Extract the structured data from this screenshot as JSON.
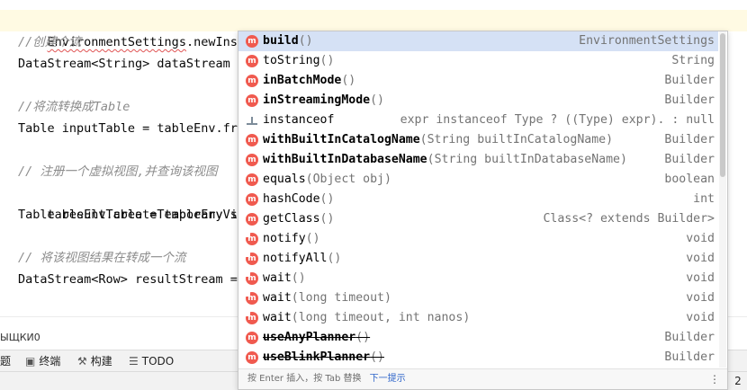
{
  "editor": {
    "lines": [
      {
        "text_a": "EnvironmentSettings",
        "text_b": ".newInstance()",
        "text_c": ".;",
        "comment": false
      },
      {
        "text": "//创建个流",
        "comment": true
      },
      {
        "text": "DataStream<String> dataStream = ",
        "comment": false
      },
      {
        "text": "//将流转换成Table",
        "comment": true
      },
      {
        "text": "Table inputTable = tableEnv.fro",
        "comment": false
      },
      {
        "text": "// 注册一个虚拟视图,并查询该视图",
        "comment": true
      },
      {
        "text": "tableEnv.createTemporaryView(",
        "hint": "s",
        "comment": false
      },
      {
        "text": "Table resultTable = tableEnv.sq",
        "comment": false
      },
      {
        "text": "// 将该视图结果在转成一个流",
        "comment": true
      },
      {
        "text": "DataStream<Row> resultStream = ",
        "comment": false
      }
    ]
  },
  "completion": {
    "items": [
      {
        "icon": "method-icon",
        "name": "build",
        "sig": "()",
        "type": "EnvironmentSettings",
        "bold": true,
        "inherited": false,
        "strike": false
      },
      {
        "icon": "method-icon",
        "name": "toString",
        "sig": "()",
        "type": "String",
        "bold": false,
        "inherited": false,
        "strike": false
      },
      {
        "icon": "method-icon",
        "name": "inBatchMode",
        "sig": "()",
        "type": "Builder",
        "bold": true,
        "inherited": false,
        "strike": false
      },
      {
        "icon": "method-icon",
        "name": "inStreamingMode",
        "sig": "()",
        "type": "Builder",
        "bold": true,
        "inherited": false,
        "strike": false
      },
      {
        "icon": "template-icon",
        "name": "instanceof",
        "sig": "",
        "type": "expr instanceof Type ? ((Type) expr). : null",
        "bold": false,
        "inherited": false,
        "strike": false
      },
      {
        "icon": "method-icon",
        "name": "withBuiltInCatalogName",
        "sig": "(String builtInCatalogName)",
        "type": "Builder",
        "bold": true,
        "inherited": false,
        "strike": false
      },
      {
        "icon": "method-icon",
        "name": "withBuiltInDatabaseName",
        "sig": "(String builtInDatabaseName)",
        "type": "Builder",
        "bold": true,
        "inherited": false,
        "strike": false
      },
      {
        "icon": "method-icon",
        "name": "equals",
        "sig": "(Object obj)",
        "type": "boolean",
        "bold": false,
        "inherited": false,
        "strike": false
      },
      {
        "icon": "method-icon",
        "name": "hashCode",
        "sig": "()",
        "type": "int",
        "bold": false,
        "inherited": false,
        "strike": false
      },
      {
        "icon": "method-icon",
        "name": "getClass",
        "sig": "()",
        "type": "Class<? extends Builder>",
        "bold": false,
        "inherited": false,
        "strike": false
      },
      {
        "icon": "method-icon",
        "name": "notify",
        "sig": "()",
        "type": "void",
        "bold": false,
        "inherited": true,
        "strike": false
      },
      {
        "icon": "method-icon",
        "name": "notifyAll",
        "sig": "()",
        "type": "void",
        "bold": false,
        "inherited": true,
        "strike": false
      },
      {
        "icon": "method-icon",
        "name": "wait",
        "sig": "()",
        "type": "void",
        "bold": false,
        "inherited": true,
        "strike": false
      },
      {
        "icon": "method-icon",
        "name": "wait",
        "sig": "(long timeout)",
        "type": "void",
        "bold": false,
        "inherited": true,
        "strike": false
      },
      {
        "icon": "method-icon",
        "name": "wait",
        "sig": "(long timeout, int nanos)",
        "type": "void",
        "bold": false,
        "inherited": true,
        "strike": false
      },
      {
        "icon": "method-icon",
        "name": "useAnyPlanner",
        "sig": "()",
        "type": "Builder",
        "bold": true,
        "inherited": false,
        "strike": true
      },
      {
        "icon": "method-icon",
        "name": "useBlinkPlanner",
        "sig": "()",
        "type": "Builder",
        "bold": true,
        "inherited": false,
        "strike": true
      }
    ],
    "badge_letter": "m",
    "footer_text": "按 Enter 插入，按 Tab 替换",
    "footer_link": "下一提示",
    "footer_menu": "⋮"
  },
  "cut_text": "ЫЩКИ0",
  "toolwindows": [
    {
      "label": "题",
      "icon": "problems-icon",
      "glyph": ""
    },
    {
      "label": "终端",
      "icon": "terminal-icon",
      "glyph": "▣"
    },
    {
      "label": "构建",
      "icon": "hammer-icon",
      "glyph": "⚒"
    },
    {
      "label": "TODO",
      "icon": "list-icon",
      "glyph": "☰"
    }
  ],
  "status": {
    "right_text": "2"
  },
  "colors": {
    "method_badge": "#f05a4f",
    "selected_row": "#d5e1f5",
    "current_line": "#fffae3",
    "link": "#2f65ca"
  }
}
